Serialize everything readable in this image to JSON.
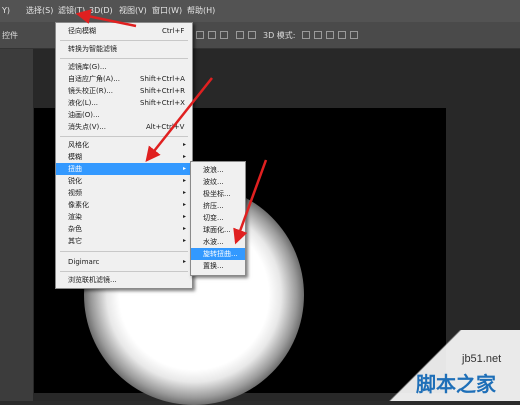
{
  "menubar": {
    "items": [
      {
        "label": "Y)"
      },
      {
        "label": "选择(S)"
      },
      {
        "label": "滤镜(T)"
      },
      {
        "label": "3D(D)"
      },
      {
        "label": "视图(V)"
      },
      {
        "label": "窗口(W)"
      },
      {
        "label": "帮助(H)"
      }
    ]
  },
  "options_bar": {
    "left_label": "控件",
    "mode_label": "3D 模式:"
  },
  "filter_menu": {
    "items": [
      {
        "label": "径向模糊",
        "shortcut": "Ctrl+F"
      },
      {
        "label": "转换为智能滤镜",
        "shortcut": ""
      },
      {
        "label": "滤镜库(G)...",
        "shortcut": ""
      },
      {
        "label": "自适应广角(A)...",
        "shortcut": "Shift+Ctrl+A"
      },
      {
        "label": "镜头校正(R)...",
        "shortcut": "Shift+Ctrl+R"
      },
      {
        "label": "液化(L)...",
        "shortcut": "Shift+Ctrl+X"
      },
      {
        "label": "油画(O)...",
        "shortcut": ""
      },
      {
        "label": "消失点(V)...",
        "shortcut": "Alt+Ctrl+V"
      },
      {
        "label": "风格化",
        "shortcut": ""
      },
      {
        "label": "模糊",
        "shortcut": ""
      },
      {
        "label": "扭曲",
        "shortcut": ""
      },
      {
        "label": "锐化",
        "shortcut": ""
      },
      {
        "label": "视频",
        "shortcut": ""
      },
      {
        "label": "像素化",
        "shortcut": ""
      },
      {
        "label": "渲染",
        "shortcut": ""
      },
      {
        "label": "杂色",
        "shortcut": ""
      },
      {
        "label": "其它",
        "shortcut": ""
      },
      {
        "label": "Digimarc",
        "shortcut": ""
      },
      {
        "label": "浏览联机滤镜...",
        "shortcut": ""
      }
    ],
    "submenu_arrow": "▸"
  },
  "distort_submenu": {
    "items": [
      {
        "label": "波浪..."
      },
      {
        "label": "波纹..."
      },
      {
        "label": "极坐标..."
      },
      {
        "label": "挤压..."
      },
      {
        "label": "切变..."
      },
      {
        "label": "球面化..."
      },
      {
        "label": "水波..."
      },
      {
        "label": "旋转扭曲..."
      },
      {
        "label": "置换..."
      }
    ]
  },
  "watermark": {
    "site": "jb51.net",
    "name": "脚本之家"
  },
  "colors": {
    "highlight": "#3399ff",
    "annotation_arrow": "#e02020"
  }
}
